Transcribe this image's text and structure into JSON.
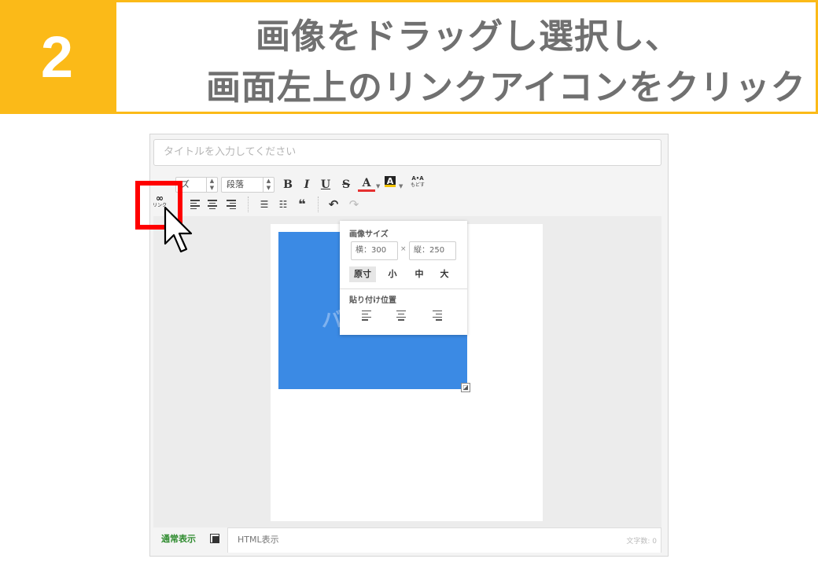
{
  "step": {
    "number": "2"
  },
  "instruction": {
    "line1": "画像をドラッグし選択し、",
    "line2": "画面左上のリンクアイコンをクリック"
  },
  "editor": {
    "title_placeholder": "タイトルを入力してください",
    "toolbar": {
      "font_size_select": "ズ",
      "paragraph_select": "段落",
      "bold": "B",
      "italic": "I",
      "underline": "U",
      "strike": "S",
      "font_color": "A",
      "bg_color": "A",
      "furigana_top": "A•A",
      "furigana_bottom": "もどす",
      "link_label": "リンク",
      "link_glyph": "∞",
      "quote": "❝",
      "undo": "↶",
      "redo": "↷"
    },
    "image_popup": {
      "size_heading": "画像サイズ",
      "width_value": "横：300",
      "height_value": "縦：250",
      "times": "×",
      "sizes": [
        "原寸",
        "小",
        "中",
        "大"
      ],
      "active_size": "原寸",
      "paste_position_heading": "貼り付け位置"
    },
    "image": {
      "text": "バ",
      "color": "#3b8ae4"
    },
    "footer": {
      "normal_view_tab": "通常表示",
      "html_view_tab": "HTML表示",
      "char_count": "文字数: 0"
    }
  },
  "colors": {
    "accent": "#fbba18",
    "highlight": "#ff0000",
    "title_text": "#707070"
  }
}
